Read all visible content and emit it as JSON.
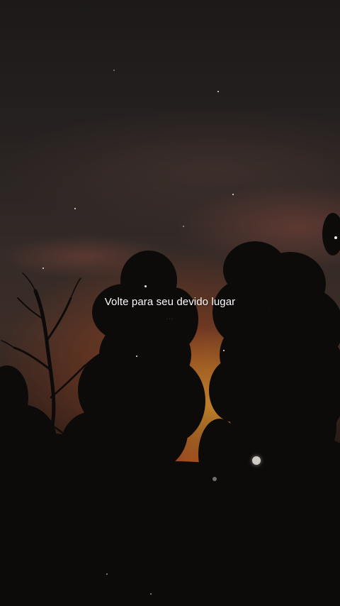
{
  "lyric": {
    "text": "Volte para seu devido lugar"
  },
  "watermark": {
    "text": "···"
  },
  "colors": {
    "sky_top": "#1c1918",
    "sunset_orange": "#d7962d",
    "sunset_red": "#c8501e",
    "tree_silhouette": "#0d0a0a",
    "text": "#ffffff"
  }
}
